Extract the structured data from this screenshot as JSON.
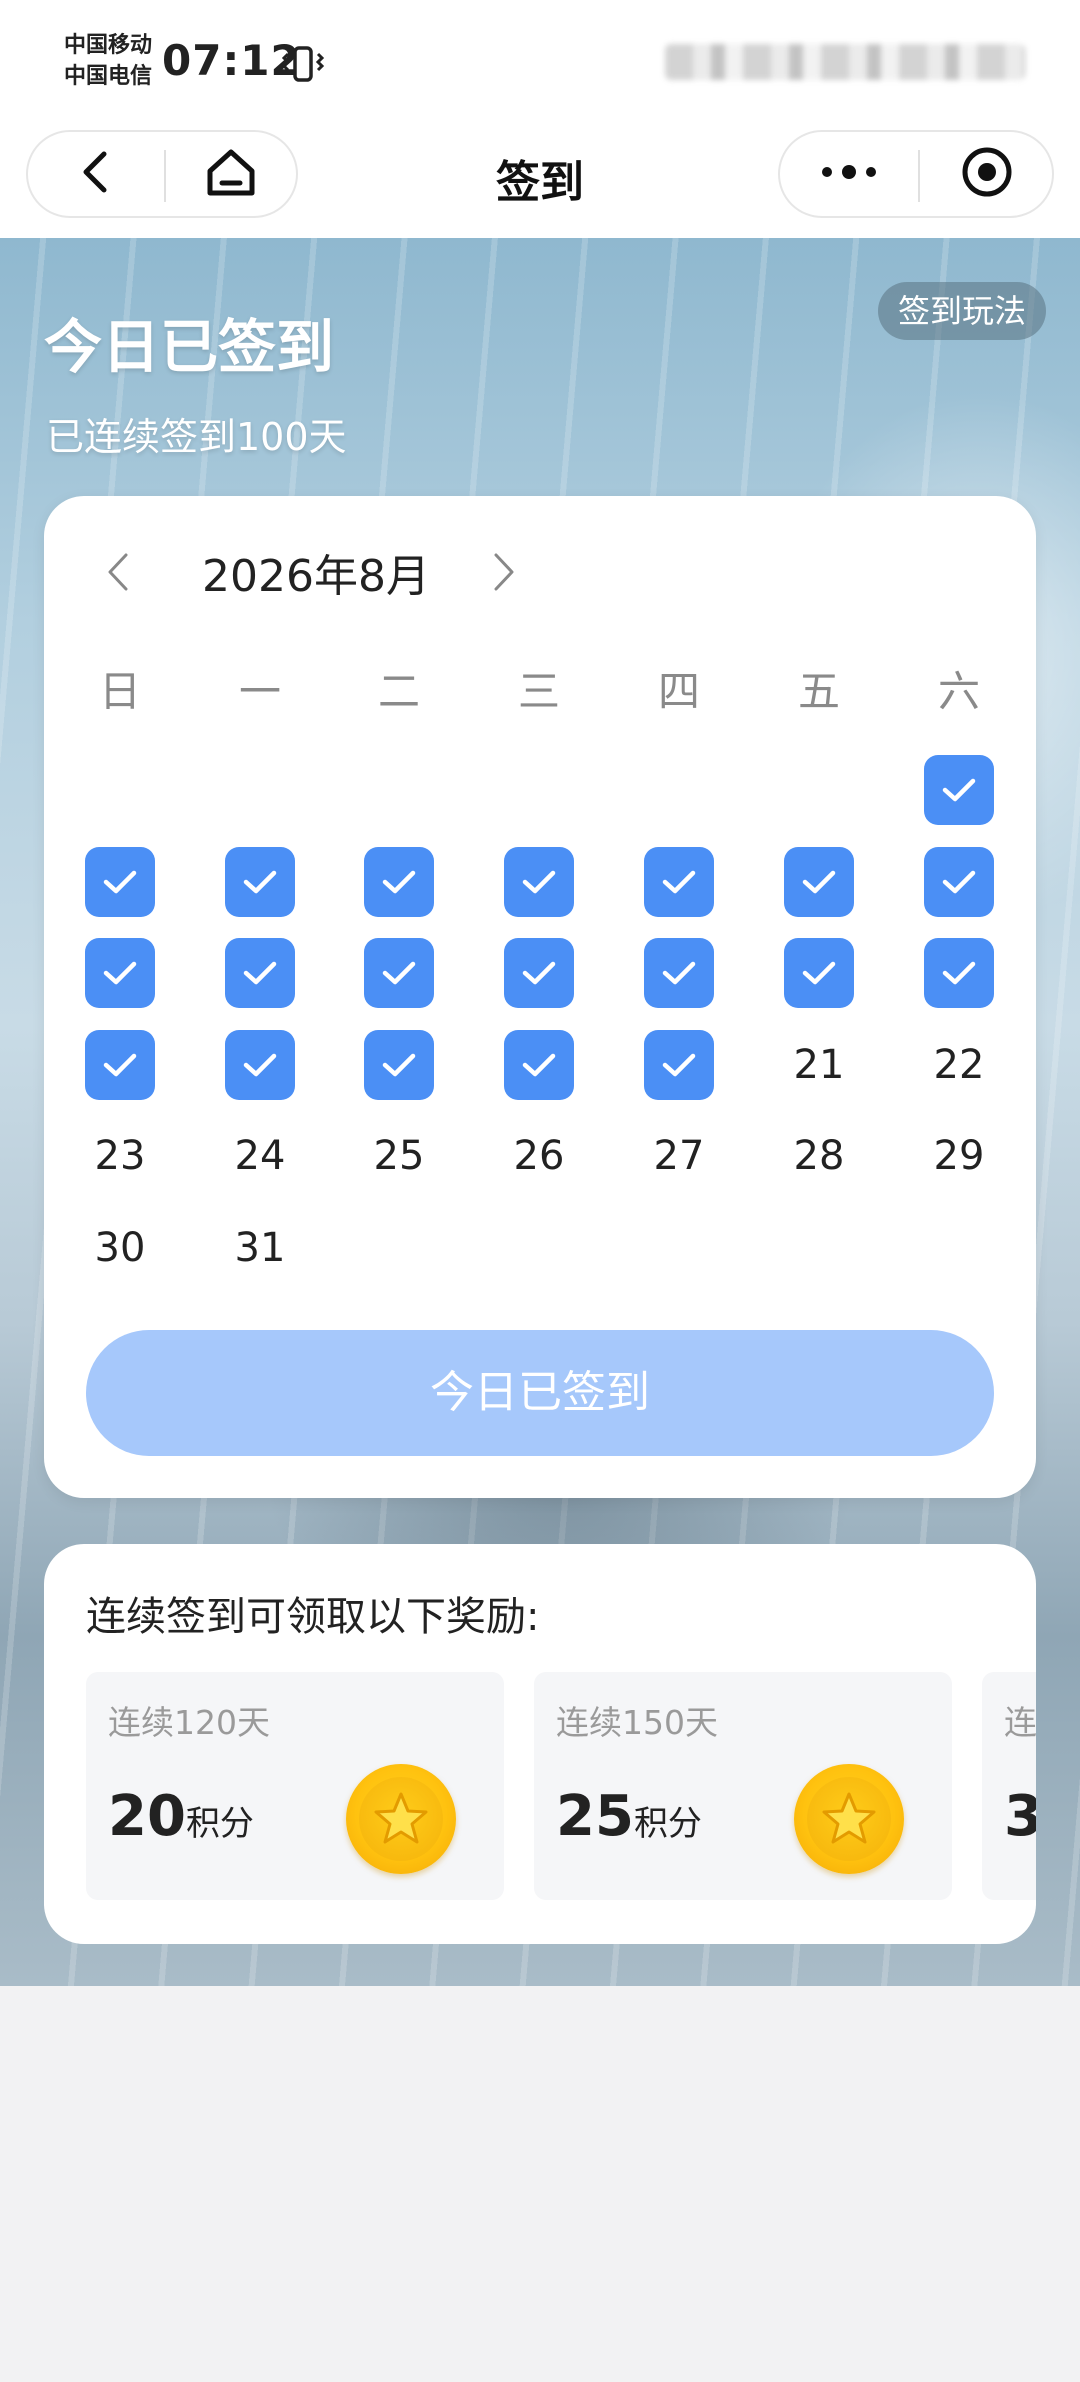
{
  "status_bar": {
    "carrier_1": "中国移动",
    "carrier_2": "中国电信",
    "time": "07:12"
  },
  "nav": {
    "title": "签到",
    "back_icon": "chevron-left-icon",
    "home_icon": "home-icon",
    "more_icon": "more-dots-icon",
    "close_icon": "target-circle-icon"
  },
  "hero": {
    "title": "今日已签到",
    "subtitle": "已连续签到100天",
    "rules_label": "签到玩法"
  },
  "calendar": {
    "month_label": "2026年8月",
    "weekdays": [
      "日",
      "一",
      "二",
      "三",
      "四",
      "五",
      "六"
    ],
    "first_weekday_index": 6,
    "days_in_month": 31,
    "checked_through_day": 20,
    "accent_color": "#4b8ff5"
  },
  "sign_button": {
    "label": "今日已签到",
    "color": "#a6c8fb"
  },
  "rewards": {
    "title": "连续签到可领取以下奖励:",
    "items": [
      {
        "days": "连续120天",
        "points": "20",
        "unit": "积分",
        "icon": "coin-star-icon"
      },
      {
        "days": "连续150天",
        "points": "25",
        "unit": "积分",
        "icon": "coin-star-icon"
      },
      {
        "days": "连",
        "points": "3",
        "unit": "",
        "icon": ""
      }
    ]
  }
}
